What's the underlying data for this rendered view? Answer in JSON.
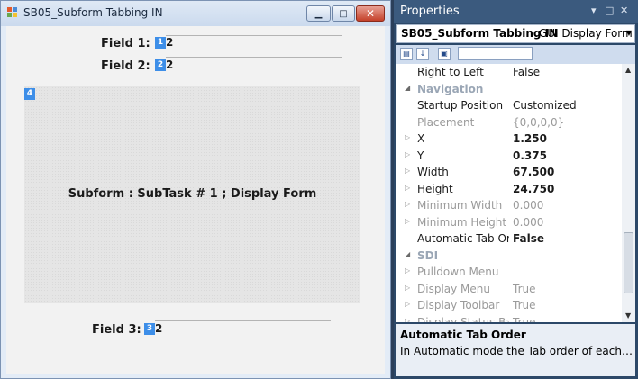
{
  "form_window": {
    "title": "SB05_Subform Tabbing IN",
    "controls": {
      "minimize": "▁",
      "maximize": "□",
      "close": "✕"
    },
    "fields": [
      {
        "label": "Field 1:",
        "tab_order": "1",
        "value": "2"
      },
      {
        "label": "Field 2:",
        "tab_order": "2",
        "value": "2"
      },
      {
        "label": "Field 3:",
        "tab_order": "3",
        "value": "2"
      }
    ],
    "subform": {
      "tab_order": "4",
      "caption": "Subform : SubTask # 1 ; Display Form"
    }
  },
  "properties_pane": {
    "title": "Properties",
    "title_controls": {
      "pin": "▾",
      "restore": "□",
      "close": "✕"
    },
    "selected_object": "SB05_Subform Tabbing IN",
    "selected_type": "GUI Display Form",
    "toolbar": [
      "categorized-view",
      "alphabetical-view",
      "property-pages"
    ],
    "rows": [
      {
        "name": "Right to Left",
        "value": "False",
        "glyph": "",
        "style": "normal"
      },
      {
        "name": "Navigation",
        "value": "",
        "glyph": "◢",
        "style": "cat"
      },
      {
        "name": "Startup Position",
        "value": "Customized",
        "glyph": "",
        "style": "normal"
      },
      {
        "name": "Placement",
        "value": "{0,0,0,0}",
        "glyph": "",
        "style": "dim"
      },
      {
        "name": "X",
        "value": "1.250",
        "glyph": "▷",
        "style": "bold"
      },
      {
        "name": "Y",
        "value": "0.375",
        "glyph": "▷",
        "style": "bold"
      },
      {
        "name": "Width",
        "value": "67.500",
        "glyph": "▷",
        "style": "bold"
      },
      {
        "name": "Height",
        "value": "24.750",
        "glyph": "▷",
        "style": "bold"
      },
      {
        "name": "Minimum Width",
        "value": "0.000",
        "glyph": "▷",
        "style": "dim"
      },
      {
        "name": "Minimum Height",
        "value": "0.000",
        "glyph": "▷",
        "style": "dim"
      },
      {
        "name": "Automatic Tab Ord",
        "value": "False",
        "glyph": "",
        "style": "bold"
      },
      {
        "name": "SDI",
        "value": "",
        "glyph": "◢",
        "style": "cat"
      },
      {
        "name": "Pulldown Menu",
        "value": "",
        "glyph": "▷",
        "style": "dim"
      },
      {
        "name": "Display Menu",
        "value": "True",
        "glyph": "▷",
        "style": "dim"
      },
      {
        "name": "Display Toolbar",
        "value": "True",
        "glyph": "▷",
        "style": "dim"
      },
      {
        "name": "Display Status Bar",
        "value": "True",
        "glyph": "▷",
        "style": "dim"
      }
    ],
    "description": {
      "title": "Automatic Tab Order",
      "text": "In Automatic mode the Tab order of each co..."
    }
  }
}
